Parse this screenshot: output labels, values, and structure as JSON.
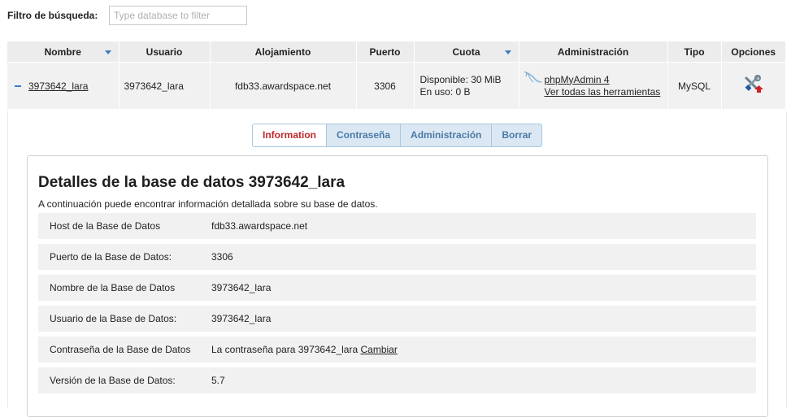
{
  "filter": {
    "label": "Filtro de búsqueda:",
    "placeholder": "Type database to filter",
    "value": ""
  },
  "table": {
    "headers": {
      "name": "Nombre",
      "user": "Usuario",
      "host": "Alojamiento",
      "port": "Puerto",
      "quota": "Cuota",
      "admin": "Administración",
      "type": "Tipo",
      "options": "Opciones"
    },
    "row": {
      "name": "3973642_lara",
      "user": "3973642_lara",
      "host": "fdb33.awardspace.net",
      "port": "3306",
      "quota_available": "Disponible: 30 MiB",
      "quota_used": "En uso: 0 B",
      "admin_link": "phpMyAdmin 4",
      "admin_tools_link": "Ver todas las herramientas",
      "type": "MySQL"
    }
  },
  "tabs": [
    {
      "label": "Information",
      "active": true
    },
    {
      "label": "Contraseña",
      "active": false
    },
    {
      "label": "Administración",
      "active": false
    },
    {
      "label": "Borrar",
      "active": false
    }
  ],
  "details": {
    "title": "Detalles de la base de datos 3973642_lara",
    "subtitle": "A continuación puede encontrar información detallada sobre su base de datos.",
    "rows": [
      {
        "label": "Host de la Base de Datos",
        "value": "fdb33.awardspace.net"
      },
      {
        "label": "Puerto de la Base de Datos:",
        "value": "3306"
      },
      {
        "label": "Nombre de la Base de Datos",
        "value": "3973642_lara"
      },
      {
        "label": "Usuario de la Base de Datos:",
        "value": "3973642_lara"
      },
      {
        "label": "Contraseña de la Base de Datos",
        "value": "La contraseña para 3973642_lara",
        "link": "Cambiar"
      },
      {
        "label": "Versión de la Base de Datos:",
        "value": "5.7"
      }
    ]
  },
  "colors": {
    "accent_blue": "#3a7fc1",
    "tab_active_text": "#c0282c",
    "tab_text": "#4a7aa7",
    "row_background": "#f1f1f1"
  },
  "icons": {
    "collapse": "minus-icon",
    "sort": "sort-down-icon",
    "admin": "phpmyadmin-icon",
    "options": "tools-icon"
  }
}
